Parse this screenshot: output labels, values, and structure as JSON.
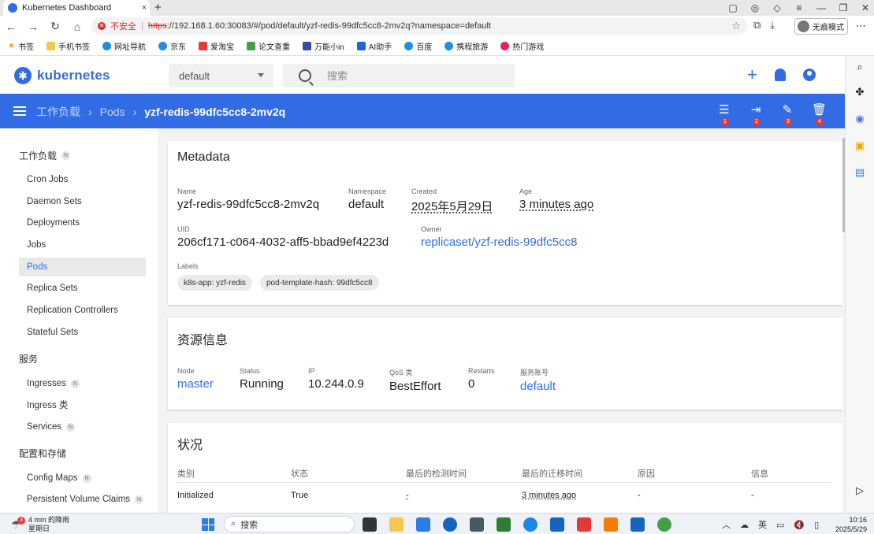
{
  "browser": {
    "tab_title": "Kubernetes Dashboard",
    "tab_close": "×",
    "new_tab": "+",
    "insecure_label": "不安全",
    "url_scheme": "https",
    "url_rest": "://192.168.1.60:30083/#/pod/default/yzf-redis-99dfc5cc8-2mv2q?namespace=default",
    "profile_label": "无痕模式",
    "bookmarks": [
      "书签",
      "手机书签",
      "网址导航",
      "京东",
      "爱淘宝",
      "论文查重",
      "万能小in",
      "AI助手",
      "百度",
      "携程旅游",
      "热门游戏"
    ]
  },
  "header": {
    "brand": "kubernetes",
    "namespace": "default",
    "search_placeholder": "搜索"
  },
  "toolbar": {
    "crumbs": [
      "工作负载",
      "Pods",
      "yzf-redis-99dfc5cc8-2mv2q"
    ],
    "action_badges": [
      "1",
      "2",
      "3",
      "4"
    ]
  },
  "sidebar": {
    "sections": [
      {
        "title": "工作负载",
        "chip": "N"
      },
      {
        "title": "服务"
      },
      {
        "title": "配置和存储"
      }
    ],
    "workloads": [
      "Cron Jobs",
      "Daemon Sets",
      "Deployments",
      "Jobs",
      "Pods",
      "Replica Sets",
      "Replication Controllers",
      "Stateful Sets"
    ],
    "services": [
      {
        "label": "Ingresses",
        "chip": "N"
      },
      {
        "label": "Ingress 类"
      },
      {
        "label": "Services",
        "chip": "N"
      }
    ],
    "config": [
      {
        "label": "Config Maps",
        "chip": "N"
      },
      {
        "label": "Persistent Volume Claims",
        "chip": "N"
      }
    ],
    "active": "Pods"
  },
  "metadata": {
    "title": "Metadata",
    "name_label": "Name",
    "name": "yzf-redis-99dfc5cc8-2mv2q",
    "namespace_label": "Namespace",
    "namespace": "default",
    "created_label": "Created",
    "created": "2025年5月29日",
    "age_label": "Age",
    "age": "3 minutes ago",
    "uid_label": "UID",
    "uid": "206cf171-c064-4032-aff5-bbad9ef4223d",
    "owner_label": "Owner",
    "owner": "replicaset/yzf-redis-99dfc5cc8",
    "labels_label": "Labels",
    "labels": [
      "k8s-app: yzf-redis",
      "pod-template-hash: 99dfc5cc8"
    ]
  },
  "resource": {
    "title": "资源信息",
    "node_label": "Node",
    "node": "master",
    "status_label": "Status",
    "status": "Running",
    "ip_label": "IP",
    "ip": "10.244.0.9",
    "qos_label": "QoS 类",
    "qos": "BestEffort",
    "restarts_label": "Restarts",
    "restarts": "0",
    "sa_label": "服务账号",
    "sa": "default"
  },
  "conditions": {
    "title": "状况",
    "columns": [
      "类别",
      "状态",
      "最后的检测时间",
      "最后的迁移时间",
      "原因",
      "信息"
    ],
    "rows": [
      {
        "type": "Initialized",
        "status": "True",
        "probe": "-",
        "transition": "3 minutes ago",
        "reason": "-",
        "message": "-"
      }
    ]
  },
  "taskbar": {
    "weather_badge": "3",
    "weather_line1": "4 mm 的降雨",
    "weather_line2": "星期日",
    "search_label": "搜索",
    "ime": "英",
    "time": "10:16",
    "date": "2025/5/29"
  },
  "colors": {
    "brand": "#326ce5",
    "badge": "#e53935",
    "insecure": "#d93025"
  }
}
